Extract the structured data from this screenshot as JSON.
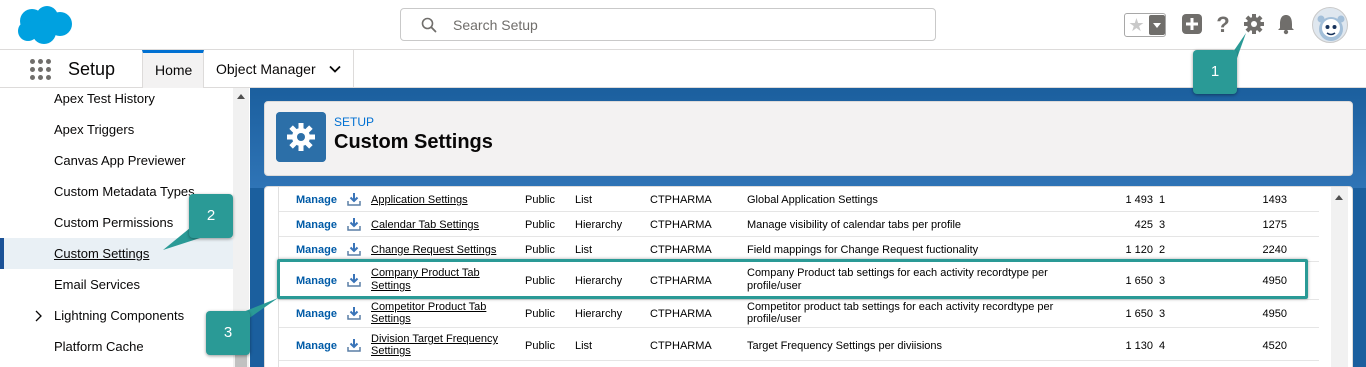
{
  "search": {
    "placeholder": "Search Setup"
  },
  "nav": {
    "app_name": "Setup",
    "tabs": [
      "Home",
      "Object Manager"
    ]
  },
  "sidebar": {
    "items": [
      {
        "label": "Apex Test History",
        "active": false
      },
      {
        "label": "Apex Triggers",
        "active": false
      },
      {
        "label": "Canvas App Previewer",
        "active": false
      },
      {
        "label": "Custom Metadata Types",
        "active": false
      },
      {
        "label": "Custom Permissions",
        "active": false
      },
      {
        "label": "Custom Settings",
        "active": true
      },
      {
        "label": "Email Services",
        "active": false
      },
      {
        "label": "Lightning Components",
        "active": false,
        "expandable": true
      },
      {
        "label": "Platform Cache",
        "active": false
      }
    ]
  },
  "page": {
    "breadcrumb": "SETUP",
    "title": "Custom Settings"
  },
  "table": {
    "rows": [
      {
        "action": "Manage",
        "name_lines": [
          "Application Settings"
        ],
        "visibility": "Public",
        "type": "List",
        "namespace": "CTPHARMA",
        "description_lines": [
          "Global Application Settings"
        ],
        "size": "1 493",
        "records": "1",
        "total": "1493"
      },
      {
        "action": "Manage",
        "name_lines": [
          "Calendar Tab Settings"
        ],
        "visibility": "Public",
        "type": "Hierarchy",
        "namespace": "CTPHARMA",
        "description_lines": [
          "Manage visibility of calendar tabs per profile"
        ],
        "size": "425",
        "records": "3",
        "total": "1275"
      },
      {
        "action": "Manage",
        "name_lines": [
          "Change Request Settings"
        ],
        "visibility": "Public",
        "type": "List",
        "namespace": "CTPHARMA",
        "description_lines": [
          "Field mappings for Change Request fuctionality"
        ],
        "size": "1 120",
        "records": "2",
        "total": "2240"
      },
      {
        "action": "Manage",
        "name_lines": [
          "Company Product Tab",
          "Settings"
        ],
        "visibility": "Public",
        "type": "Hierarchy",
        "namespace": "CTPHARMA",
        "description_lines": [
          "Company Product tab settings for each activity recordtype per",
          "profile/user"
        ],
        "size": "1 650",
        "records": "3",
        "total": "4950"
      },
      {
        "action": "Manage",
        "name_lines": [
          "Competitor Product Tab",
          "Settings"
        ],
        "visibility": "Public",
        "type": "Hierarchy",
        "namespace": "CTPHARMA",
        "description_lines": [
          "Competitor product tab settings for each activity recordtype per",
          "profile/user"
        ],
        "size": "1 650",
        "records": "3",
        "total": "4950"
      },
      {
        "action": "Manage",
        "name_lines": [
          "Division Target Frequency",
          "Settings"
        ],
        "visibility": "Public",
        "type": "List",
        "namespace": "CTPHARMA",
        "description_lines": [
          "Target Frequency Settings per diviisions"
        ],
        "size": "1 130",
        "records": "4",
        "total": "4520"
      }
    ]
  },
  "callouts": [
    "1",
    "2",
    "3"
  ],
  "colors": {
    "callout": "#2a9a96",
    "brand_blue": "#1b5f9e",
    "link_blue": "#015ba7",
    "logo": "#00a1e0"
  },
  "icons": [
    "salesforce-logo",
    "search-icon",
    "star-icon",
    "add-icon",
    "help-icon",
    "gear-icon",
    "bell-icon",
    "avatar",
    "app-launcher-icon",
    "chevron-down-icon",
    "chevron-right-icon",
    "download-icon"
  ]
}
